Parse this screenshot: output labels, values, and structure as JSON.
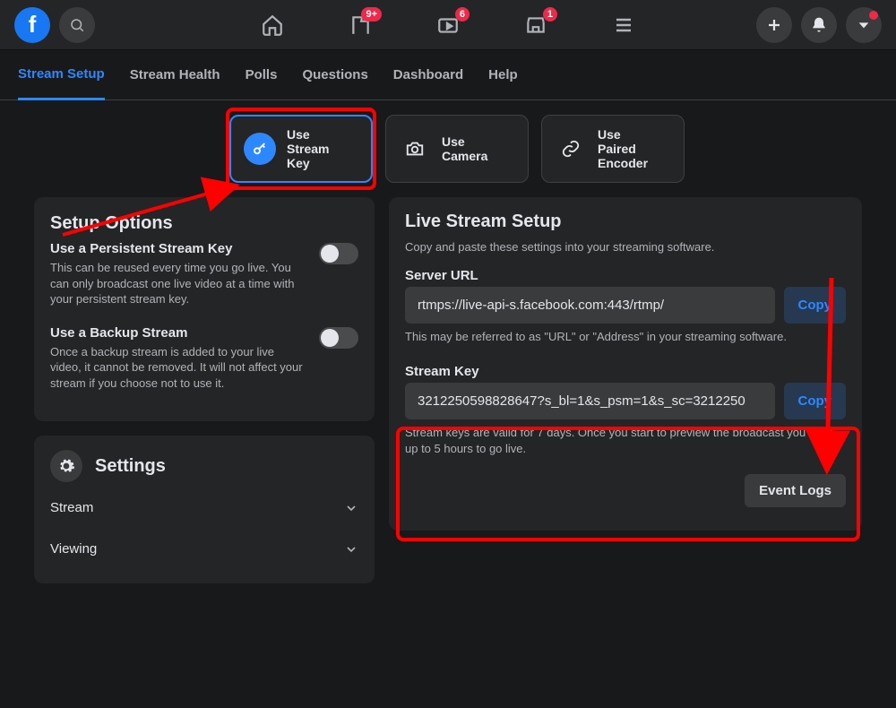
{
  "topbar": {
    "badges": {
      "pages": "9+",
      "watch": "6",
      "market": "1"
    }
  },
  "subnav": {
    "items": [
      "Stream Setup",
      "Stream Health",
      "Polls",
      "Questions",
      "Dashboard",
      "Help"
    ],
    "active_index": 0
  },
  "methods": [
    {
      "label_l1": "Use",
      "label_l2": "Stream",
      "label_l3": "Key"
    },
    {
      "label_l1": "Use",
      "label_l2": "Camera",
      "label_l3": ""
    },
    {
      "label_l1": "Use",
      "label_l2": "Paired",
      "label_l3": "Encoder"
    }
  ],
  "setup_options": {
    "heading": "Setup Options",
    "persistent": {
      "title": "Use a Persistent Stream Key",
      "desc": "This can be reused every time you go live. You can only broadcast one live video at a time with your persistent stream key."
    },
    "backup": {
      "title": "Use a Backup Stream",
      "desc": "Once a backup stream is added to your live video, it cannot be removed. It will not affect your stream if you choose not to use it."
    }
  },
  "settings": {
    "heading": "Settings",
    "rows": [
      "Stream",
      "Viewing"
    ]
  },
  "live_setup": {
    "heading": "Live Stream Setup",
    "subheading": "Copy and paste these settings into your streaming software.",
    "server_url": {
      "label": "Server URL",
      "value": "rtmps://live-api-s.facebook.com:443/rtmp/",
      "copy": "Copy",
      "hint": "This may be referred to as \"URL\" or \"Address\" in your streaming software."
    },
    "stream_key": {
      "label": "Stream Key",
      "value": "3212250598828647?s_bl=1&s_psm=1&s_sc=3212250",
      "copy": "Copy",
      "hint": "Stream keys are valid for 7 days. Once you start to preview the broadcast you have up to 5 hours to go live."
    },
    "event_logs": "Event Logs"
  }
}
